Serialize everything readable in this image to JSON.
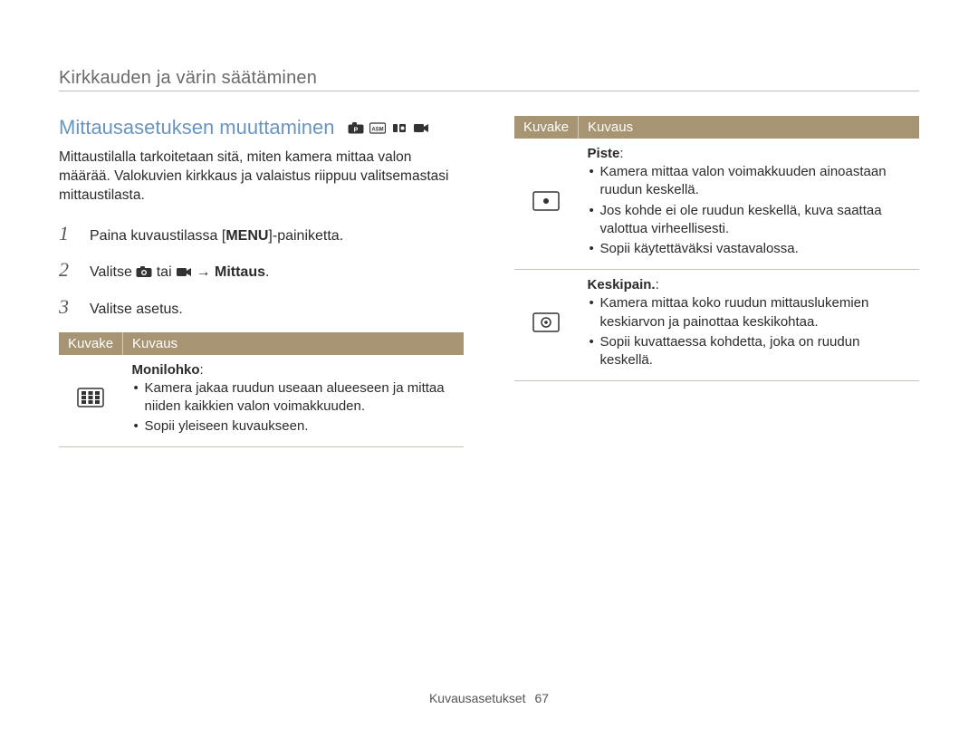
{
  "header": {
    "breadcrumb": "Kirkkauden ja värin säätäminen"
  },
  "main": {
    "title": "Mittausasetuksen muuttaminen",
    "mode_icons": [
      "camera-p-mode-icon",
      "asm-mode-icon",
      "dual-mode-icon",
      "video-mode-icon"
    ],
    "intro": "Mittaustilalla tarkoitetaan sitä, miten kamera mittaa valon määrää. Valokuvien kirkkaus ja valaistus riippuu valitsemastasi mittaustilasta.",
    "steps": [
      {
        "num": "1",
        "before": "Paina kuvaustilassa [",
        "kw": "MENU",
        "after": "]-painiketta."
      },
      {
        "num": "2",
        "text_parts": {
          "a": "Valitse ",
          "b": " tai ",
          "c": " → ",
          "d": "Mittaus",
          "e": "."
        }
      },
      {
        "num": "3",
        "plain": "Valitse asetus."
      }
    ],
    "table": {
      "headers": [
        "Kuvake",
        "Kuvaus"
      ],
      "rows": [
        {
          "icon_name": "multi-zone-metering-icon",
          "title": "Monilohko",
          "bullets": [
            "Kamera jakaa ruudun useaan alueeseen ja mittaa niiden kaikkien valon voimakkuuden.",
            "Sopii yleiseen kuvaukseen."
          ]
        }
      ]
    }
  },
  "right": {
    "table": {
      "headers": [
        "Kuvake",
        "Kuvaus"
      ],
      "rows": [
        {
          "icon_name": "spot-metering-icon",
          "title": "Piste",
          "bullets": [
            "Kamera mittaa valon voimakkuuden ainoastaan ruudun keskellä.",
            "Jos kohde ei ole ruudun keskellä, kuva saattaa valottua virheellisesti.",
            "Sopii käytettäväksi vastavalossa."
          ]
        },
        {
          "icon_name": "center-weighted-metering-icon",
          "title": "Keskipain.",
          "bullets": [
            "Kamera mittaa koko ruudun mittauslukemien keskiarvon ja painottaa keskikohtaa.",
            "Sopii kuvattaessa kohdetta, joka on ruudun keskellä."
          ]
        }
      ]
    }
  },
  "footer": {
    "section": "Kuvausasetukset",
    "page": "67"
  }
}
